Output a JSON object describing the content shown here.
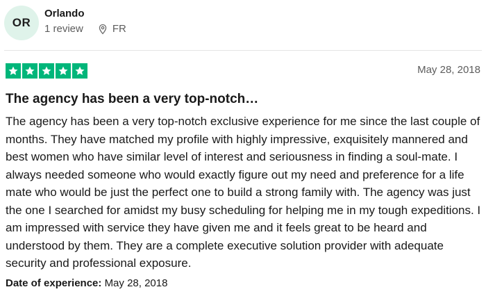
{
  "reviewer": {
    "initials": "OR",
    "name": "Orlando",
    "review_count": "1 review",
    "country": "FR",
    "avatar_color": "#dff3ea"
  },
  "review": {
    "rating": 5,
    "max_rating": 5,
    "star_color": "#00b67a",
    "date": "May 28, 2018",
    "title": "The agency has been a very top-notch…",
    "body": "The agency has been a very top-notch exclusive experience for me since the last couple of months. They have matched my profile with highly impressive, exquisitely mannered and best women who have similar level of interest and seriousness in finding a soul-mate. I always needed someone who would exactly figure out my need and preference for a life mate who would be just the perfect one to build a strong family with. The agency was just the one I searched for amidst my busy scheduling for helping me in my tough expeditions. I am impressed with service they have given me and it feels great to be heard and understood by them. They are a complete executive solution provider with adequate security and professional exposure.",
    "experience_label": "Date of experience:",
    "experience_date": "May 28, 2018"
  },
  "icons": {
    "location": "location-pin-icon",
    "star": "star-icon"
  }
}
